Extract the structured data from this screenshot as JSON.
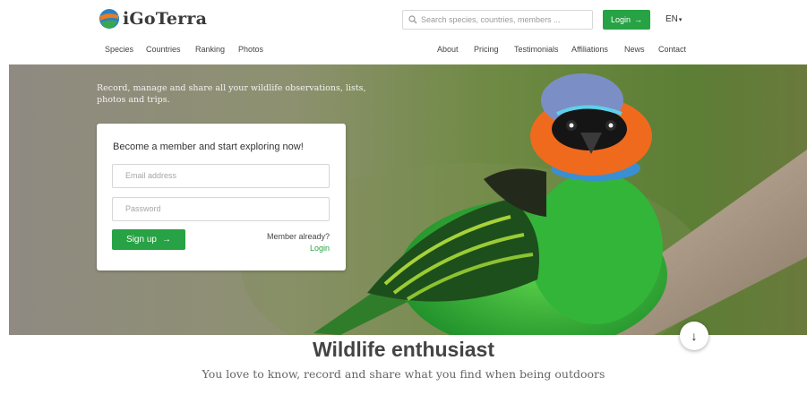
{
  "brand": {
    "name": "iGoTerra"
  },
  "search": {
    "placeholder": "Search species, countries, members ...",
    "icon": "search-icon"
  },
  "login_button": {
    "label": "Login",
    "arrow": "→"
  },
  "language": {
    "selected": "EN",
    "caret": "▾"
  },
  "nav_left": [
    "Species",
    "Countries",
    "Ranking",
    "Photos"
  ],
  "nav_right": [
    "About",
    "Pricing",
    "Testimonials",
    "Affiliations",
    "News",
    "Contact"
  ],
  "hero": {
    "tagline": "Record, manage and share all your wildlife observations, lists, photos and trips."
  },
  "signup_card": {
    "title": "Become a member and start exploring now!",
    "email_placeholder": "Email address",
    "password_placeholder": "Password",
    "signup_label": "Sign up",
    "signup_arrow": "→",
    "member_text": "Member already?",
    "member_link": "Login"
  },
  "scroll_down": {
    "glyph": "↓"
  },
  "section": {
    "headline": "Wildlife enthusiast",
    "subline": "You love to know, record and share what you find when being outdoors"
  },
  "colors": {
    "accent": "#27a244",
    "text": "#333333"
  }
}
